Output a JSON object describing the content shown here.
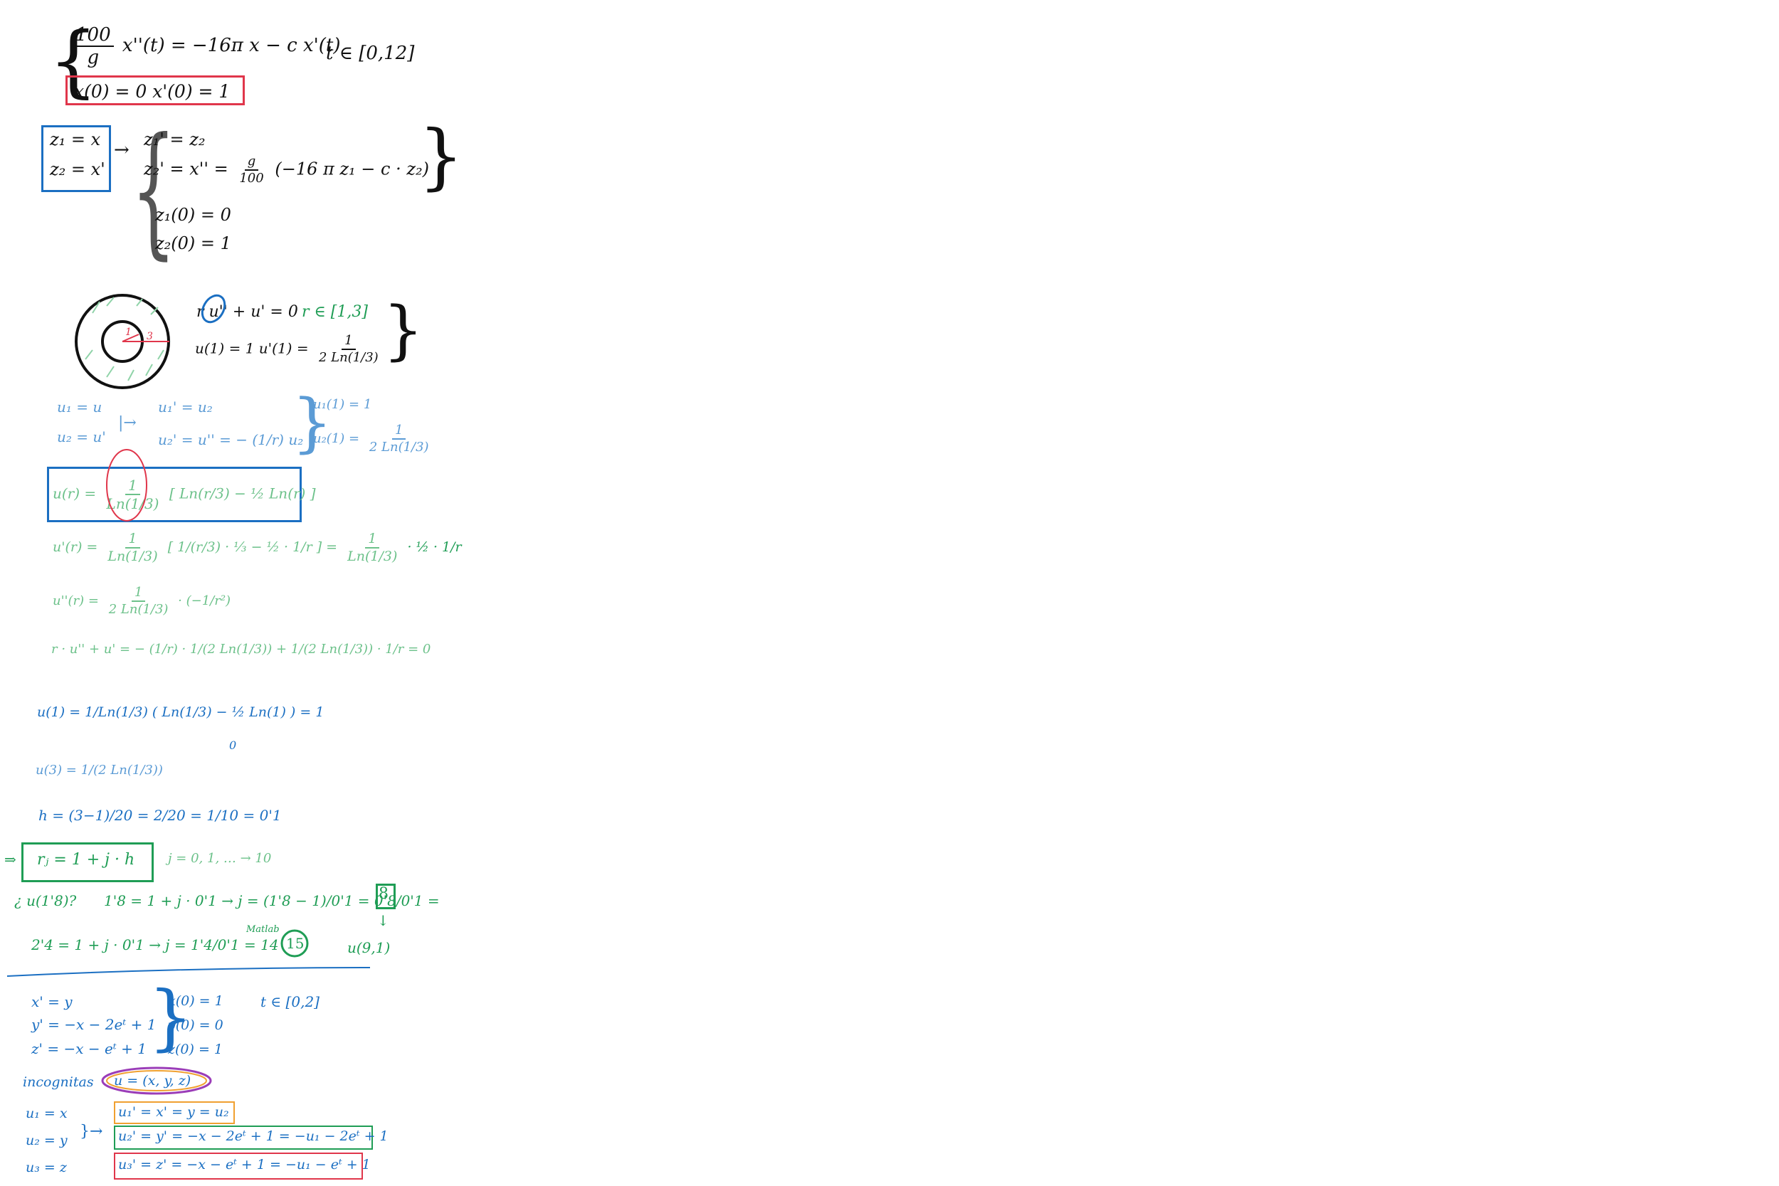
{
  "colors": {
    "black": "#111111",
    "blue": "#1b6fc2",
    "light_blue": "#5b9bd5",
    "green": "#1f9d55",
    "light_green": "#6cc18a",
    "red": "#e0364b",
    "purple": "#9b3db8",
    "orange": "#f0a030"
  },
  "problem1": {
    "ode_coef_num": "100",
    "ode_coef_den": "g",
    "ode_rest": "x''(t) = −16π x − c x'(t)",
    "interval": "t ∈ [0,12]",
    "ic": "x(0) = 0     x'(0) = 1",
    "sub_z1": "z₁ = x",
    "sub_z2": "z₂ = x'",
    "sys1": "z₁' = z₂",
    "sys2_lhs": "z₂' = x'' =",
    "sys2_num": "g",
    "sys2_den": "100",
    "sys2_rhs": "(−16 π z₁ − c · z₂)",
    "ic1": "z₁(0) = 0",
    "ic2": "z₂(0) = 1"
  },
  "problem2": {
    "annulus_r1": "1",
    "annulus_r2": "3",
    "ode": "r u'' + u' = 0",
    "range": "r ∈ [1,3]",
    "bc": "u(1) = 1    u'(1) =",
    "bc_num": "1",
    "bc_den": "2 Ln(1/3)",
    "u1": "u₁ = u",
    "u2": "u₂ = u'",
    "eq1": "u₁' = u₂",
    "eq2": "u₂' = u'' = − (1/r) u₂",
    "ic1": "u₁(1) = 1",
    "ic2_lhs": "u₂(1) =",
    "ic2_num": "1",
    "ic2_den": "2 Ln(1/3)",
    "sol_lhs": "u(r) =",
    "sol_num": "1",
    "sol_den": "Ln(1/3)",
    "sol_rhs": "[ Ln(r/3) − ½ Ln(r) ]",
    "deriv_lhs": "u'(r) =",
    "deriv_mid": "[ 1/(r/3) · ⅓ − ½ · 1/r ] =",
    "deriv_rhs": "· ½ · 1/r",
    "second_lhs": "u''(r) =",
    "second_rhs": "· (−1/r²)",
    "check": "r · u'' + u' = − (1/r) · 1/(2 Ln(1/3)) + 1/(2 Ln(1/3)) · 1/r = 0",
    "check_u1": "u(1) = 1/Ln(1/3) ( Ln(1/3) − ½ Ln(1) ) = 1",
    "check_u1_zero": "0",
    "u3": "u(3) = 1/(2 Ln(1/3))",
    "h": "h = (3−1)/20 = 2/20 = 1/10 = 0'1",
    "grid": "rⱼ = 1 + j · h",
    "j_range": "j = 0, 1, … → 10",
    "q_lhs": "¿ u(1'8)?",
    "q_body": "1'8 = 1 + j · 0'1 → j = (1'8 − 1)/0'1 = 0'8/0'1 =",
    "q_ans": "8",
    "matlab_line": "2'4 = 1 + j · 0'1 → j = 1'4/0'1 = 14",
    "matlab_label": "Matlab",
    "matlab_ans": "15",
    "u_idx": "u(9,1)"
  },
  "problem3": {
    "eq1": "x' = y",
    "eq2": "y' = −x − 2eᵗ + 1",
    "eq3": "z' = −x − eᵗ + 1",
    "ic1": "x(0) = 1",
    "ic2": "y(0) = 0",
    "ic3": "z(0) = 1",
    "interval": "t ∈ [0,2]",
    "incog_label": "incognitas",
    "incog_val": "u = (x, y, z)",
    "s1": "u₁ = x",
    "s2": "u₂ = y",
    "s3": "u₃ = z",
    "r1": "u₁' = x' = y = u₂",
    "r2": "u₂' = y' = −x − 2eᵗ + 1 = −u₁ − 2eᵗ + 1",
    "r3": "u₃' = z' = −x − eᵗ + 1 = −u₁ − eᵗ + 1"
  }
}
